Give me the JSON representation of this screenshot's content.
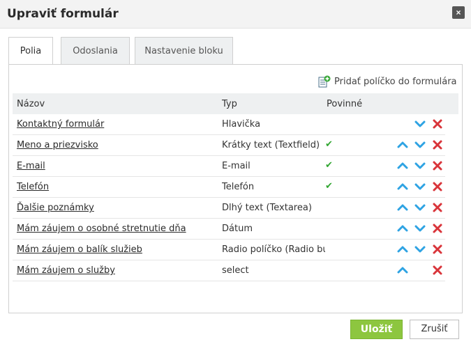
{
  "dialog": {
    "title": "Upraviť formulár",
    "close_label": "×"
  },
  "tabs": [
    {
      "label": "Polia"
    },
    {
      "label": "Odoslania"
    },
    {
      "label": "Nastavenie bloku"
    }
  ],
  "toolbar": {
    "add_field_label": "Pridať políčko do formulára"
  },
  "table": {
    "headers": {
      "name": "Názov",
      "type": "Typ",
      "required": "Povinné"
    },
    "rows": [
      {
        "name": "Kontaktný formulár",
        "type": "Hlavička",
        "required": "",
        "up": false,
        "down": true
      },
      {
        "name": "Meno a priezvisko",
        "type": "Krátky text (Textfield)",
        "required": "✔",
        "up": true,
        "down": true
      },
      {
        "name": "E-mail",
        "type": "E-mail",
        "required": "✔",
        "up": true,
        "down": true
      },
      {
        "name": "Telefón",
        "type": "Telefón",
        "required": "✔",
        "up": true,
        "down": true
      },
      {
        "name": "Ďalšie poznámky",
        "type": "Dlhý text (Textarea)",
        "required": "",
        "up": true,
        "down": true
      },
      {
        "name": "Mám záujem o osobné stretnutie dňa",
        "type": "Dátum",
        "required": "",
        "up": true,
        "down": true
      },
      {
        "name": "Mám záujem o balík služieb",
        "type": "Radio políčko (Radio but",
        "required": "",
        "up": true,
        "down": true
      },
      {
        "name": "Mám záujem o služby",
        "type": "select",
        "required": "",
        "up": true,
        "down": false
      }
    ]
  },
  "footer": {
    "save_label": "Uložiť",
    "cancel_label": "Zrušiť"
  },
  "colors": {
    "save": "#8dc63f",
    "arrow": "#2ea3e3",
    "delete": "#d9343a",
    "check": "#2fa52f"
  }
}
